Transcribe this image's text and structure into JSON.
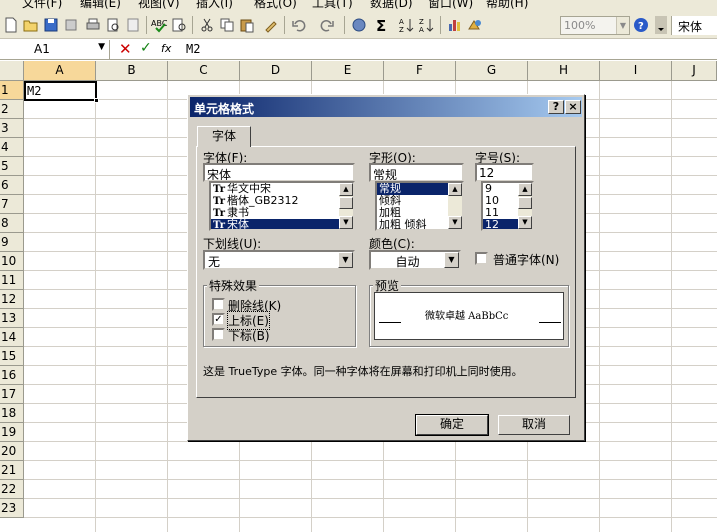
{
  "menu": [
    "文件(F)",
    "编辑(E)",
    "视图(V)",
    "插入(I)",
    "格式(O)",
    "工具(T)",
    "数据(D)",
    "窗口(W)",
    "帮助(H)"
  ],
  "toolbar": {
    "zoom_value": "100%",
    "font_name": "宋体",
    "icons": [
      "new-icon",
      "open-icon",
      "save-icon",
      "permission-icon",
      "print-icon",
      "print-preview-icon",
      "spelling-icon",
      "research-icon",
      "cut-icon",
      "copy-icon",
      "paste-icon",
      "format-painter-icon",
      "undo-icon",
      "redo-icon",
      "hyperlink-icon",
      "autosum-icon",
      "sort-ascending-icon",
      "sort-descending-icon",
      "chart-icon",
      "drawing-icon",
      "help-icon"
    ]
  },
  "formula_bar": {
    "name_box": "A1",
    "fx": "fx",
    "content": "M2"
  },
  "sheet": {
    "columns": [
      "A",
      "B",
      "C",
      "D",
      "E",
      "F",
      "G",
      "H",
      "I",
      "J"
    ],
    "rows": [
      "1",
      "2",
      "3",
      "4",
      "5",
      "6",
      "7",
      "8",
      "9",
      "10",
      "11",
      "12",
      "13",
      "14",
      "15",
      "16",
      "17",
      "18",
      "19",
      "20",
      "21",
      "22",
      "23"
    ],
    "cell_a1": "M2"
  },
  "dialog": {
    "title": "单元格格式",
    "help_btn": "?",
    "close_btn": "×",
    "tab": "字体",
    "font_label": "字体(F):",
    "font_value": "宋体",
    "font_list": [
      "华文中宋",
      "楷体_GB2312",
      "隶书",
      "宋体"
    ],
    "style_label": "字形(O):",
    "style_value": "常规",
    "style_list": [
      "常规",
      "倾斜",
      "加粗",
      "加粗 倾斜"
    ],
    "size_label": "字号(S):",
    "size_value": "12",
    "size_list": [
      "9",
      "10",
      "11",
      "12"
    ],
    "underline_label": "下划线(U):",
    "underline_value": "无",
    "color_label": "颜色(C):",
    "color_value": "自动",
    "normal_font_label": "普通字体(N)",
    "normal_font_checked": false,
    "effects_label": "特殊效果",
    "effects": [
      {
        "label": "删除线(K)",
        "checked": false
      },
      {
        "label": "上标(E)",
        "checked": true
      },
      {
        "label": "下标(B)",
        "checked": false
      }
    ],
    "preview_label": "预览",
    "preview_text": "微软卓越 AaBbCc",
    "info_text": "这是 TrueType 字体。同一种字体将在屏幕和打印机上同时使用。",
    "ok": "确定",
    "cancel": "取消"
  }
}
